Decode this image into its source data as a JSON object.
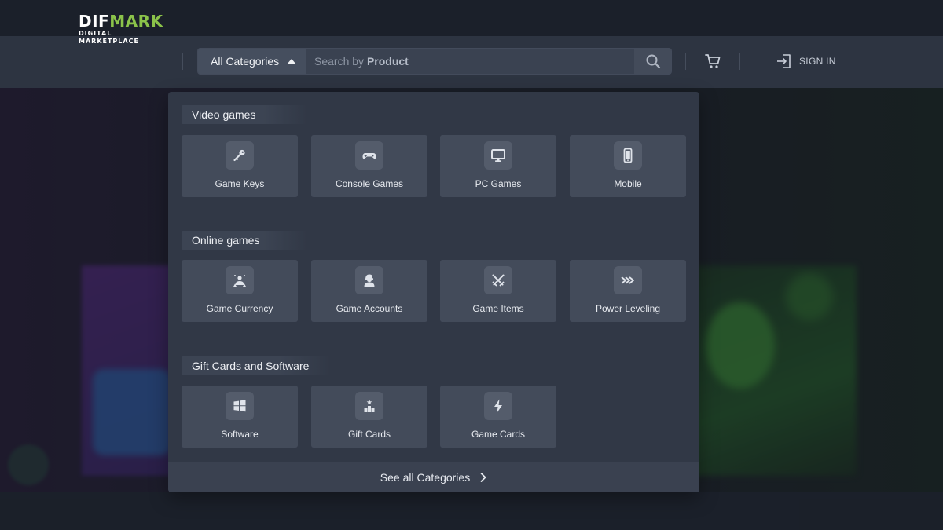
{
  "header": {
    "logo": {
      "main": "DIFMARK",
      "main_white": "DIF",
      "main_green": "MARK",
      "sub": "DIGITAL MARKETPLACE"
    },
    "category_button": {
      "label": "All Categories",
      "icon": "caret-up-icon"
    },
    "search": {
      "placeholder_prefix": "Search by",
      "placeholder_emphasis": "Product",
      "icon": "search-icon"
    },
    "cart_icon": "cart-icon",
    "sign_in": {
      "label": "SIGN IN",
      "icon": "sign-in-icon"
    }
  },
  "menu": {
    "sections": [
      {
        "title": "Video games",
        "items": [
          {
            "label": "Game Keys",
            "icon": "key-icon"
          },
          {
            "label": "Console Games",
            "icon": "gamepad-icon"
          },
          {
            "label": "PC Games",
            "icon": "monitor-icon"
          },
          {
            "label": "Mobile",
            "icon": "mobile-icon"
          }
        ]
      },
      {
        "title": "Online games",
        "items": [
          {
            "label": "Game Currency",
            "icon": "currency-icon"
          },
          {
            "label": "Game Accounts",
            "icon": "account-icon"
          },
          {
            "label": "Game Items",
            "icon": "crossed-swords-icon"
          },
          {
            "label": "Power Leveling",
            "icon": "power-leveling-icon"
          }
        ]
      },
      {
        "title": "Gift Cards and Software",
        "items": [
          {
            "label": "Software",
            "icon": "windows-icon"
          },
          {
            "label": "Gift Cards",
            "icon": "gift-card-icon"
          },
          {
            "label": "Game Cards",
            "icon": "lightning-icon"
          }
        ]
      }
    ],
    "footer": {
      "label": "See all Categories",
      "icon": "chevron-right-icon"
    }
  },
  "colors": {
    "logo_accent": "#8bc34a",
    "header_bg": "#2d3441",
    "panel_bg": "#313846",
    "tile_bg": "#434b5a"
  }
}
